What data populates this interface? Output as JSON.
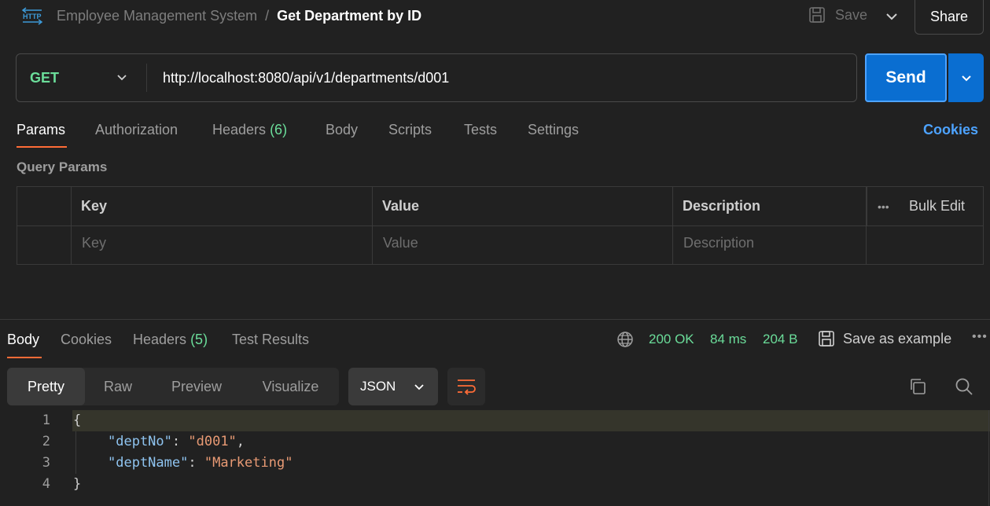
{
  "header": {
    "icon_text": "HTTP",
    "collection": "Employee Management System",
    "separator": "/",
    "request_title": "Get Department by ID",
    "save_label": "Save",
    "share_label": "Share"
  },
  "request": {
    "method": "GET",
    "url": "http://localhost:8080/api/v1/departments/d001",
    "send_label": "Send"
  },
  "request_tabs": [
    {
      "label": "Params",
      "count": ""
    },
    {
      "label": "Authorization",
      "count": ""
    },
    {
      "label": "Headers",
      "count": "(6)"
    },
    {
      "label": "Body",
      "count": ""
    },
    {
      "label": "Scripts",
      "count": ""
    },
    {
      "label": "Tests",
      "count": ""
    },
    {
      "label": "Settings",
      "count": ""
    }
  ],
  "cookies_link": "Cookies",
  "query_params": {
    "label": "Query Params",
    "headers": {
      "key": "Key",
      "value": "Value",
      "description": "Description",
      "bulk_edit": "Bulk Edit",
      "more": "•••"
    },
    "placeholders": {
      "key": "Key",
      "value": "Value",
      "description": "Description"
    }
  },
  "response_tabs": [
    {
      "label": "Body",
      "count": ""
    },
    {
      "label": "Cookies",
      "count": ""
    },
    {
      "label": "Headers",
      "count": "(5)"
    },
    {
      "label": "Test Results",
      "count": ""
    }
  ],
  "response_status": {
    "status": "200 OK",
    "time": "84 ms",
    "size": "204 B",
    "save_example": "Save as example",
    "more": "•••"
  },
  "view_modes": [
    "Pretty",
    "Raw",
    "Preview",
    "Visualize"
  ],
  "format": "JSON",
  "code_lines": [
    {
      "n": "1",
      "text": "{"
    },
    {
      "n": "2",
      "key": "\"deptNo\"",
      "value": "\"d001\"",
      "trail": ","
    },
    {
      "n": "3",
      "key": "\"deptName\"",
      "value": "\"Marketing\"",
      "trail": ""
    },
    {
      "n": "4",
      "text": "}"
    }
  ],
  "colors": {
    "accent": "#ff6c37",
    "send": "#0a6ed1",
    "method_get": "#6bdd9a",
    "link": "#4da3ff"
  }
}
